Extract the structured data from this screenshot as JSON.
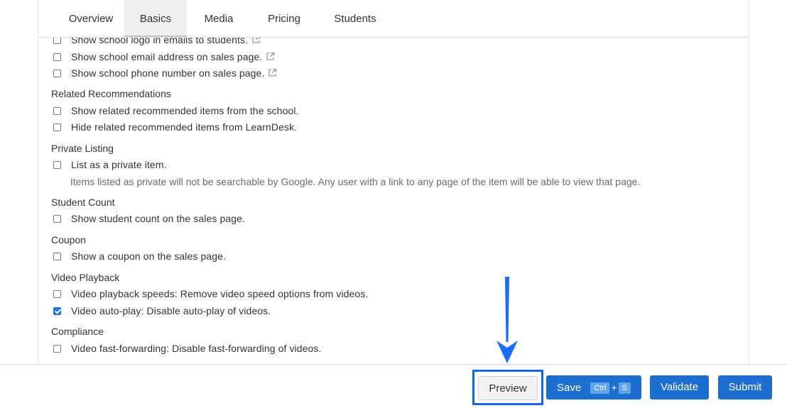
{
  "tabs": [
    "Overview",
    "Basics",
    "Media",
    "Pricing",
    "Students"
  ],
  "active_tab": "Basics",
  "settings": {
    "school_logo_email": "Show school logo in emails to students.",
    "school_email_sales": "Show school email address on sales page.",
    "school_phone_sales": "Show school phone number on sales page.",
    "related_heading": "Related Recommendations",
    "related_school": "Show related recommended items from the school.",
    "related_learndesk": "Hide related recommended items from LearnDesk.",
    "private_heading": "Private Listing",
    "private_item": "List as a private item.",
    "private_note": "Items listed as private will not be searchable by Google. Any user with a link to any page of the item will be able to view that page.",
    "student_heading": "Student Count",
    "student_count": "Show student count on the sales page.",
    "coupon_heading": "Coupon",
    "coupon": "Show a coupon on the sales page.",
    "video_heading": "Video Playback",
    "video_speeds": "Video playback speeds: Remove video speed options from videos.",
    "video_autoplay": "Video auto-play: Disable auto-play of videos.",
    "compliance_heading": "Compliance",
    "video_ff": "Video fast-forwarding: Disable fast-forwarding of videos."
  },
  "checked": {
    "video_autoplay": true
  },
  "footer": {
    "preview": "Preview",
    "save": "Save",
    "save_key1": "Ctrl",
    "save_plus": "+",
    "save_key2": "S",
    "validate": "Validate",
    "submit": "Submit"
  },
  "colors": {
    "accent": "#1c6fd0",
    "highlight": "#1565f0",
    "arrow": "#1a6ef5"
  },
  "icons": {
    "external": "external-link-icon",
    "arrow": "down-arrow-annotation"
  }
}
